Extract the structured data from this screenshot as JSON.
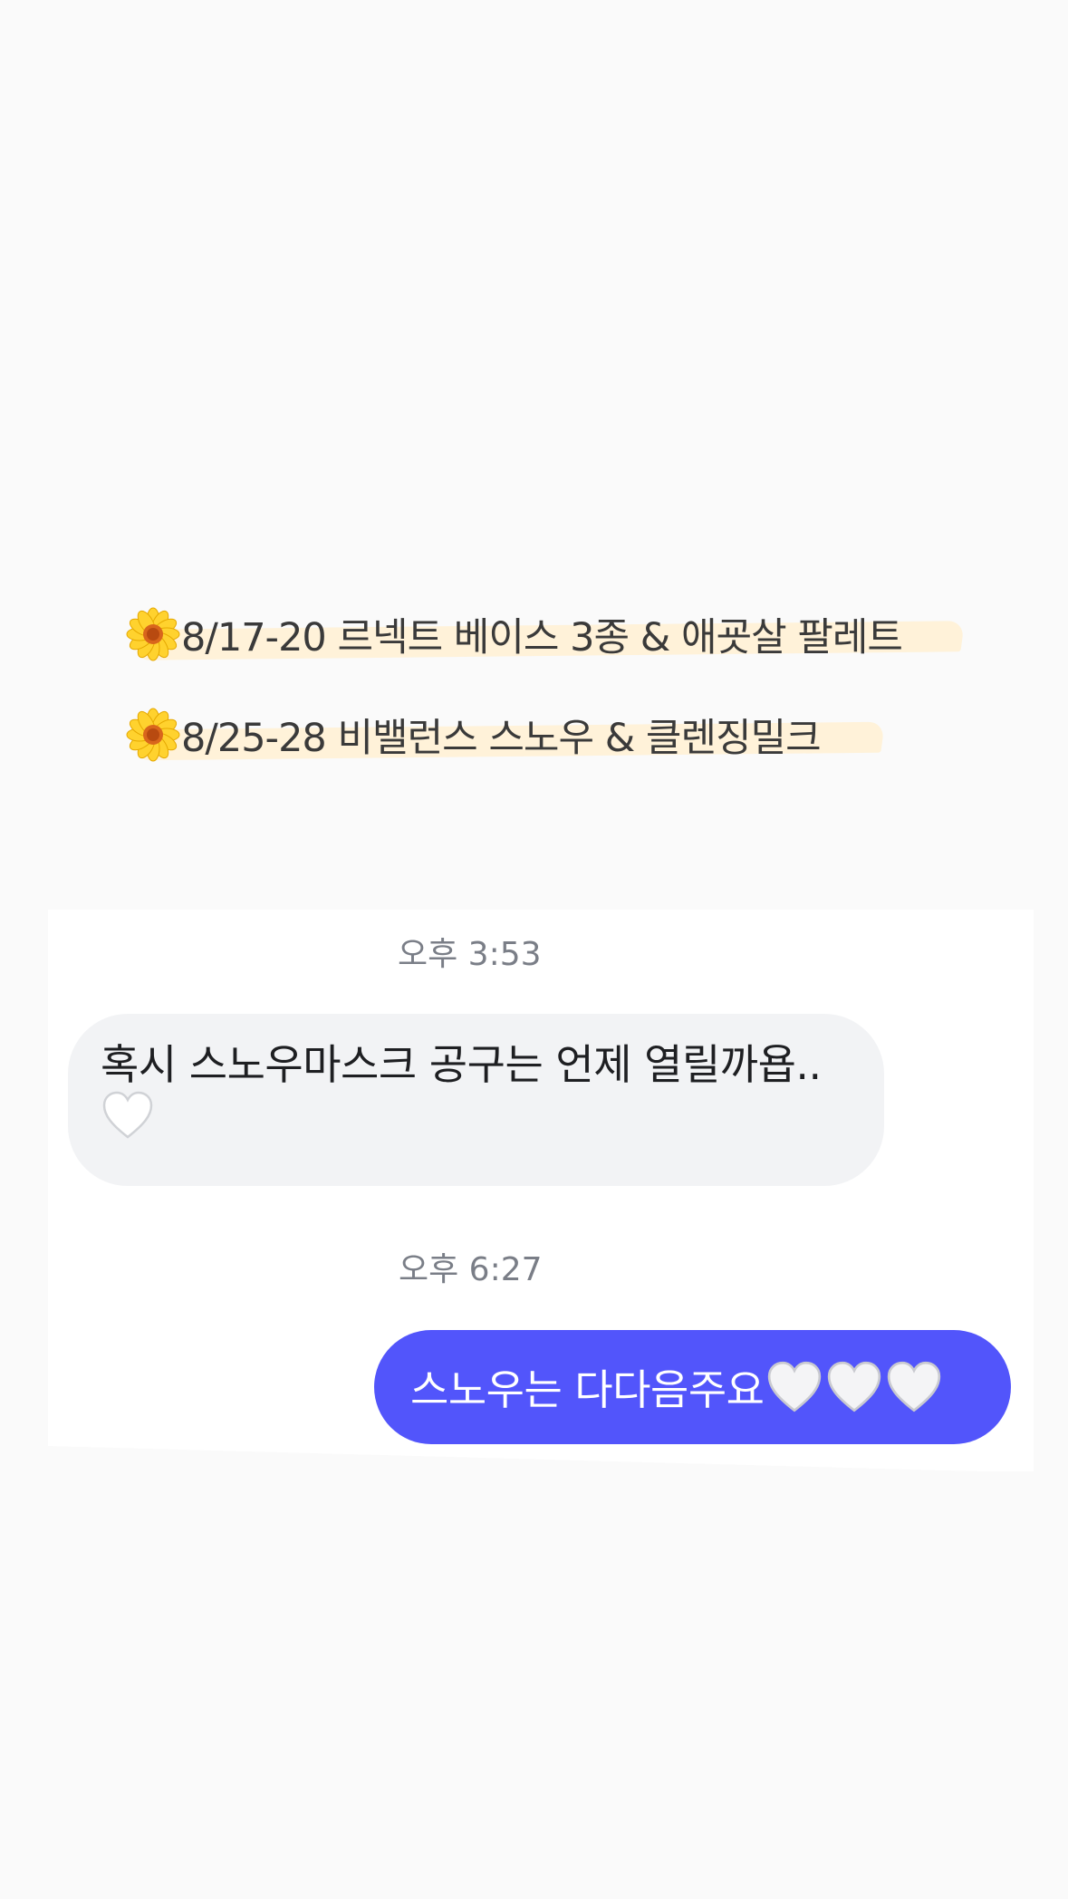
{
  "schedule": {
    "icon": "sunflower-icon",
    "items": [
      {
        "text": "8/17-20 르넥트 베이스 3종 & 애굣살 팔레트"
      },
      {
        "text": "8/25-28 비밸런스 스노우 & 클렌징밀크"
      }
    ],
    "highlight_color": "#fff1d6"
  },
  "chat": {
    "timestamps": [
      "오후 3:53",
      "오후 6:27"
    ],
    "received": {
      "line1": "혹시 스노우마스크 공구는 언제 열릴까욥..",
      "emoji": "white-heart-icon"
    },
    "sent": {
      "text": "스노우는 다다음주요",
      "emoji": "white-heart-icon",
      "emoji_count": 3
    },
    "colors": {
      "sent_bubble": "#5255fb",
      "received_bubble": "#f2f3f5",
      "timestamp": "#7a7e87"
    }
  }
}
